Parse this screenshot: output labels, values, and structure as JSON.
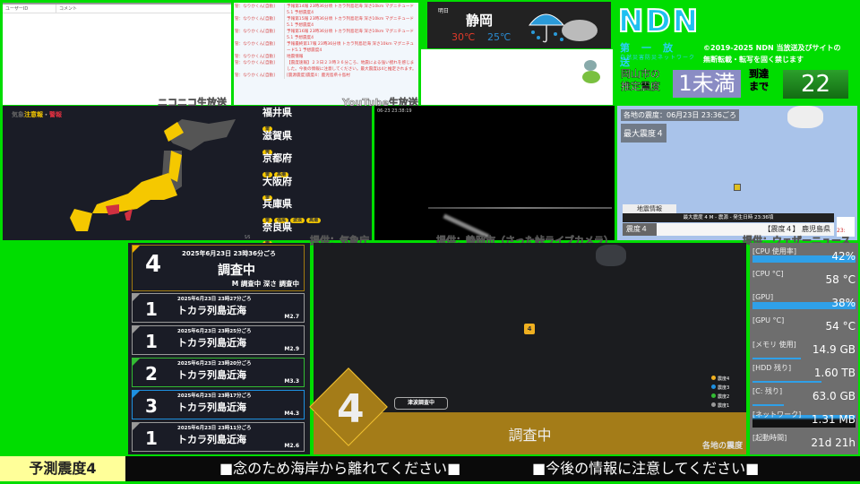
{
  "nico": {
    "col_user": "ユーザーID",
    "col_comment": "コメント",
    "label": "ニコニコ生放送"
  },
  "youtube": {
    "label": "YouTube生放送",
    "messages": [
      {
        "user": "管：なりかくん[自動]",
        "text": "予報第14報 23時36分頃 トカラ列島近海 深さ10km マグニチュード5.1 予想震度4"
      },
      {
        "user": "管：なりかくん[自動]",
        "text": "予報第15報 23時36分頃 トカラ列島近海 深さ10km マグニチュード5.1 予想震度4"
      },
      {
        "user": "管：なりかくん[自動]",
        "text": "予報第16報 23時36分頃 トカラ列島近海 深さ10km マグニチュード5.1 予想震度4"
      },
      {
        "user": "管：なりかくん[自動]",
        "text": "予報最終第17報 23時36分頃 トカラ列島近海 深さ10km マグニチュード5.1 予想震度4"
      },
      {
        "user": "管：なりかくん[自動]",
        "text": "地震情報"
      },
      {
        "user": "管：なりかくん[自動]",
        "text": "【震度速報】２３日２３時３６分ころ、地震による強い揺れを感じました。今後の情報に注意してください。最大震度は4と推定されます。"
      },
      {
        "user": "管：なりかくん[自動]",
        "text": "[震源震度]震度4：鹿児島県十島村"
      }
    ]
  },
  "weather": {
    "day": "明日",
    "city": "静岡",
    "high": "30℃",
    "low": "25℃",
    "icon": "umbrella-rain-cloud-icon"
  },
  "brand": {
    "logo": "NDN",
    "sub1": "第一放送",
    "sub2": "自然災害防災ネットワーク",
    "copyright1": "©2019-2025 NDN 当放送及びサイトの",
    "copyright2": "無断転載・転写を固く禁じます"
  },
  "estimate": {
    "label1": "岡山市の",
    "label2": "推定震度",
    "value": "1未満",
    "arrival_label1": "到達",
    "arrival_label2": "まで",
    "arrival": "22"
  },
  "jma": {
    "title_a": "気象",
    "title_b": "注意報",
    "sep": "・",
    "title_c": "警報",
    "page": "5/5",
    "credit": "提供：気象庁",
    "prefs": [
      {
        "name": "福井県",
        "tags": [
          "雷"
        ]
      },
      {
        "name": "滋賀県",
        "tags": [
          "雷"
        ]
      },
      {
        "name": "京都府",
        "tags": [
          "雷",
          "高潮"
        ]
      },
      {
        "name": "大阪府",
        "tags": [
          "雷"
        ]
      },
      {
        "name": "兵庫県",
        "tags": [
          "雷",
          "強風",
          "波浪",
          "高潮"
        ]
      },
      {
        "name": "奈良県",
        "tags": [
          "雷"
        ]
      }
    ]
  },
  "camera": {
    "timestamp": "06-23 23:38:19",
    "credit": "提供：静岡市（さった峠ライブカメラ）"
  },
  "weathernews": {
    "header": "各地の震度：06月23日 23:36ごろ",
    "max": "最大震度４",
    "panel": "地震情報",
    "info": "最大震度 4  M -  震源 -  発生日時 23:36頃",
    "shindo": "震度４",
    "ticker": "【震度４】 鹿児島県",
    "clock": "23:",
    "credit": "提供：ウェザーニュース"
  },
  "quakes": [
    {
      "int": "4",
      "time": "2025年6月23日 23時36分ごろ",
      "place": "調査中",
      "mag": "M 調査中  深さ 調査中",
      "color": "#f0b000"
    },
    {
      "int": "1",
      "time": "2025年6月23日 23時27分ごろ",
      "place": "トカラ列島近海",
      "mag": "M2.7",
      "color": "#999999"
    },
    {
      "int": "1",
      "time": "2025年6月23日 23時25分ごろ",
      "place": "トカラ列島近海",
      "mag": "M2.9",
      "color": "#999999"
    },
    {
      "int": "2",
      "time": "2025年6月23日 23時20分ごろ",
      "place": "トカラ列島近海",
      "mag": "M3.3",
      "color": "#33bb33"
    },
    {
      "int": "3",
      "time": "2025年6月23日 23時17分ごろ",
      "place": "トカラ列島近海",
      "mag": "M4.3",
      "color": "#1e90e0"
    },
    {
      "int": "1",
      "time": "2025年6月23日 23時11分ごろ",
      "place": "トカラ列島近海",
      "mag": "M2.6",
      "color": "#999999"
    }
  ],
  "intmap": {
    "marker": "4",
    "big": "4",
    "tsunami": "津波調査中",
    "status": "調査中",
    "caption": "各地の震度",
    "legend": [
      {
        "label": "震度4",
        "color": "#f0b020"
      },
      {
        "label": "震度3",
        "color": "#1e90e0"
      },
      {
        "label": "震度2",
        "color": "#33bb33"
      },
      {
        "label": "震度1",
        "color": "#999999"
      }
    ]
  },
  "system": [
    {
      "k": "[CPU 使用率]",
      "v": "42%",
      "fill": 0.42
    },
    {
      "k": "[CPU °C]",
      "v": "58 °C"
    },
    {
      "k": "[GPU]",
      "v": "38%",
      "fill": 0.38
    },
    {
      "k": "[GPU °C]",
      "v": "54 °C"
    },
    {
      "k": "[メモリ 使用]",
      "v": "14.9 GB",
      "fill": 0.47
    },
    {
      "k": "[HDD 残り]",
      "v": "1.60 TB",
      "fill": 0.67
    },
    {
      "k": "[C: 残り]",
      "v": "63.0 GB",
      "fill": 0.3
    },
    {
      "k": "[ネットワーク]",
      "v": "1.31 MB"
    },
    {
      "k": "[起動時間]",
      "v": "21d 21h"
    }
  ],
  "bottom": {
    "label": "予測震度4",
    "msg1": "■念のため海岸から離れてください■",
    "msg2": "■今後の情報に注意してください■"
  }
}
